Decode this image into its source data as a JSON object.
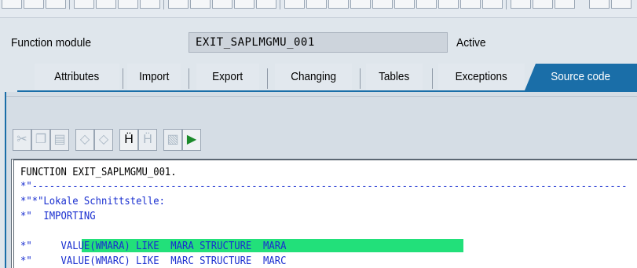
{
  "header": {
    "function_module_label": "Function module",
    "function_module_value": "EXIT_SAPLMGMU_001",
    "status": "Active"
  },
  "tabs": [
    {
      "label": "Attributes",
      "active": false
    },
    {
      "label": "Import",
      "active": false
    },
    {
      "label": "Export",
      "active": false
    },
    {
      "label": "Changing",
      "active": false
    },
    {
      "label": "Tables",
      "active": false
    },
    {
      "label": "Exceptions",
      "active": false
    },
    {
      "label": "Source code",
      "active": true
    }
  ],
  "editor_toolbar": {
    "buttons": [
      {
        "name": "cut-icon",
        "enabled": false
      },
      {
        "name": "copy-icon",
        "enabled": false
      },
      {
        "name": "paste-icon",
        "enabled": false
      },
      {
        "name": "undo-icon",
        "enabled": false
      },
      {
        "name": "redo-icon",
        "enabled": false
      },
      {
        "name": "find-icon",
        "enabled": true
      },
      {
        "name": "find-next-icon",
        "enabled": false
      },
      {
        "name": "insert-statement-icon",
        "enabled": false
      },
      {
        "name": "pattern-icon",
        "enabled": true
      }
    ]
  },
  "code": {
    "lines": [
      "FUNCTION EXIT_SAPLMGMU_001.",
      "*\"-------------------------------------------------------------------------------------------------------",
      "*\"*\"Lokale Schnittstelle:",
      "*\"  IMPORTING",
      "*\"     VALUE(WMARA) LIKE  MARA STRUCTURE  MARA",
      "*\"     VALUE(WMARC) LIKE  MARC STRUCTURE  MARC"
    ]
  },
  "colors": {
    "tab_active": "#1a6ea8",
    "highlight": "#22e07a",
    "comment": "#1a2fd0"
  }
}
